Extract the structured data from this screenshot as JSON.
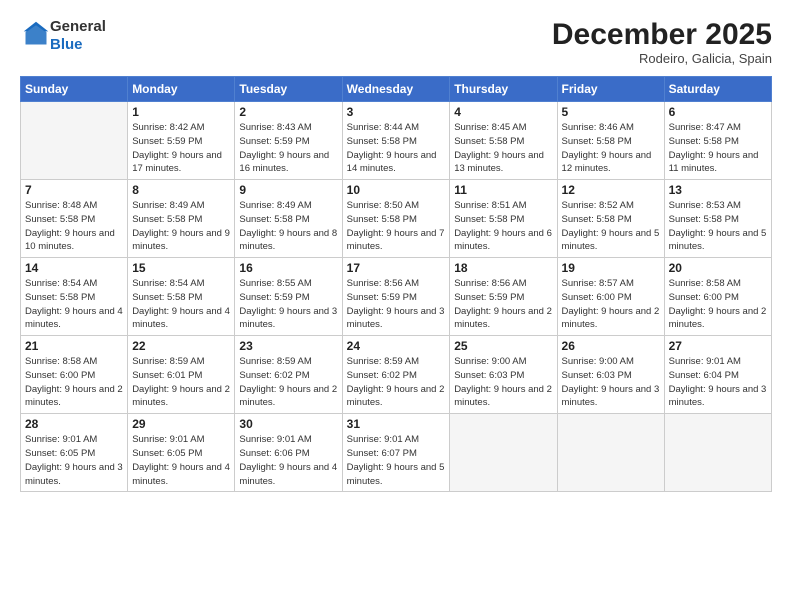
{
  "logo": {
    "general": "General",
    "blue": "Blue"
  },
  "header": {
    "month": "December 2025",
    "location": "Rodeiro, Galicia, Spain"
  },
  "weekdays": [
    "Sunday",
    "Monday",
    "Tuesday",
    "Wednesday",
    "Thursday",
    "Friday",
    "Saturday"
  ],
  "weeks": [
    [
      {
        "day": "",
        "empty": true
      },
      {
        "day": "1",
        "sunrise": "Sunrise: 8:42 AM",
        "sunset": "Sunset: 5:59 PM",
        "daylight": "Daylight: 9 hours and 17 minutes."
      },
      {
        "day": "2",
        "sunrise": "Sunrise: 8:43 AM",
        "sunset": "Sunset: 5:59 PM",
        "daylight": "Daylight: 9 hours and 16 minutes."
      },
      {
        "day": "3",
        "sunrise": "Sunrise: 8:44 AM",
        "sunset": "Sunset: 5:58 PM",
        "daylight": "Daylight: 9 hours and 14 minutes."
      },
      {
        "day": "4",
        "sunrise": "Sunrise: 8:45 AM",
        "sunset": "Sunset: 5:58 PM",
        "daylight": "Daylight: 9 hours and 13 minutes."
      },
      {
        "day": "5",
        "sunrise": "Sunrise: 8:46 AM",
        "sunset": "Sunset: 5:58 PM",
        "daylight": "Daylight: 9 hours and 12 minutes."
      },
      {
        "day": "6",
        "sunrise": "Sunrise: 8:47 AM",
        "sunset": "Sunset: 5:58 PM",
        "daylight": "Daylight: 9 hours and 11 minutes."
      }
    ],
    [
      {
        "day": "7",
        "sunrise": "Sunrise: 8:48 AM",
        "sunset": "Sunset: 5:58 PM",
        "daylight": "Daylight: 9 hours and 10 minutes."
      },
      {
        "day": "8",
        "sunrise": "Sunrise: 8:49 AM",
        "sunset": "Sunset: 5:58 PM",
        "daylight": "Daylight: 9 hours and 9 minutes."
      },
      {
        "day": "9",
        "sunrise": "Sunrise: 8:49 AM",
        "sunset": "Sunset: 5:58 PM",
        "daylight": "Daylight: 9 hours and 8 minutes."
      },
      {
        "day": "10",
        "sunrise": "Sunrise: 8:50 AM",
        "sunset": "Sunset: 5:58 PM",
        "daylight": "Daylight: 9 hours and 7 minutes."
      },
      {
        "day": "11",
        "sunrise": "Sunrise: 8:51 AM",
        "sunset": "Sunset: 5:58 PM",
        "daylight": "Daylight: 9 hours and 6 minutes."
      },
      {
        "day": "12",
        "sunrise": "Sunrise: 8:52 AM",
        "sunset": "Sunset: 5:58 PM",
        "daylight": "Daylight: 9 hours and 5 minutes."
      },
      {
        "day": "13",
        "sunrise": "Sunrise: 8:53 AM",
        "sunset": "Sunset: 5:58 PM",
        "daylight": "Daylight: 9 hours and 5 minutes."
      }
    ],
    [
      {
        "day": "14",
        "sunrise": "Sunrise: 8:54 AM",
        "sunset": "Sunset: 5:58 PM",
        "daylight": "Daylight: 9 hours and 4 minutes."
      },
      {
        "day": "15",
        "sunrise": "Sunrise: 8:54 AM",
        "sunset": "Sunset: 5:58 PM",
        "daylight": "Daylight: 9 hours and 4 minutes."
      },
      {
        "day": "16",
        "sunrise": "Sunrise: 8:55 AM",
        "sunset": "Sunset: 5:59 PM",
        "daylight": "Daylight: 9 hours and 3 minutes."
      },
      {
        "day": "17",
        "sunrise": "Sunrise: 8:56 AM",
        "sunset": "Sunset: 5:59 PM",
        "daylight": "Daylight: 9 hours and 3 minutes."
      },
      {
        "day": "18",
        "sunrise": "Sunrise: 8:56 AM",
        "sunset": "Sunset: 5:59 PM",
        "daylight": "Daylight: 9 hours and 2 minutes."
      },
      {
        "day": "19",
        "sunrise": "Sunrise: 8:57 AM",
        "sunset": "Sunset: 6:00 PM",
        "daylight": "Daylight: 9 hours and 2 minutes."
      },
      {
        "day": "20",
        "sunrise": "Sunrise: 8:58 AM",
        "sunset": "Sunset: 6:00 PM",
        "daylight": "Daylight: 9 hours and 2 minutes."
      }
    ],
    [
      {
        "day": "21",
        "sunrise": "Sunrise: 8:58 AM",
        "sunset": "Sunset: 6:00 PM",
        "daylight": "Daylight: 9 hours and 2 minutes."
      },
      {
        "day": "22",
        "sunrise": "Sunrise: 8:59 AM",
        "sunset": "Sunset: 6:01 PM",
        "daylight": "Daylight: 9 hours and 2 minutes."
      },
      {
        "day": "23",
        "sunrise": "Sunrise: 8:59 AM",
        "sunset": "Sunset: 6:02 PM",
        "daylight": "Daylight: 9 hours and 2 minutes."
      },
      {
        "day": "24",
        "sunrise": "Sunrise: 8:59 AM",
        "sunset": "Sunset: 6:02 PM",
        "daylight": "Daylight: 9 hours and 2 minutes."
      },
      {
        "day": "25",
        "sunrise": "Sunrise: 9:00 AM",
        "sunset": "Sunset: 6:03 PM",
        "daylight": "Daylight: 9 hours and 2 minutes."
      },
      {
        "day": "26",
        "sunrise": "Sunrise: 9:00 AM",
        "sunset": "Sunset: 6:03 PM",
        "daylight": "Daylight: 9 hours and 3 minutes."
      },
      {
        "day": "27",
        "sunrise": "Sunrise: 9:01 AM",
        "sunset": "Sunset: 6:04 PM",
        "daylight": "Daylight: 9 hours and 3 minutes."
      }
    ],
    [
      {
        "day": "28",
        "sunrise": "Sunrise: 9:01 AM",
        "sunset": "Sunset: 6:05 PM",
        "daylight": "Daylight: 9 hours and 3 minutes."
      },
      {
        "day": "29",
        "sunrise": "Sunrise: 9:01 AM",
        "sunset": "Sunset: 6:05 PM",
        "daylight": "Daylight: 9 hours and 4 minutes."
      },
      {
        "day": "30",
        "sunrise": "Sunrise: 9:01 AM",
        "sunset": "Sunset: 6:06 PM",
        "daylight": "Daylight: 9 hours and 4 minutes."
      },
      {
        "day": "31",
        "sunrise": "Sunrise: 9:01 AM",
        "sunset": "Sunset: 6:07 PM",
        "daylight": "Daylight: 9 hours and 5 minutes."
      },
      {
        "day": "",
        "empty": true
      },
      {
        "day": "",
        "empty": true
      },
      {
        "day": "",
        "empty": true
      }
    ]
  ]
}
